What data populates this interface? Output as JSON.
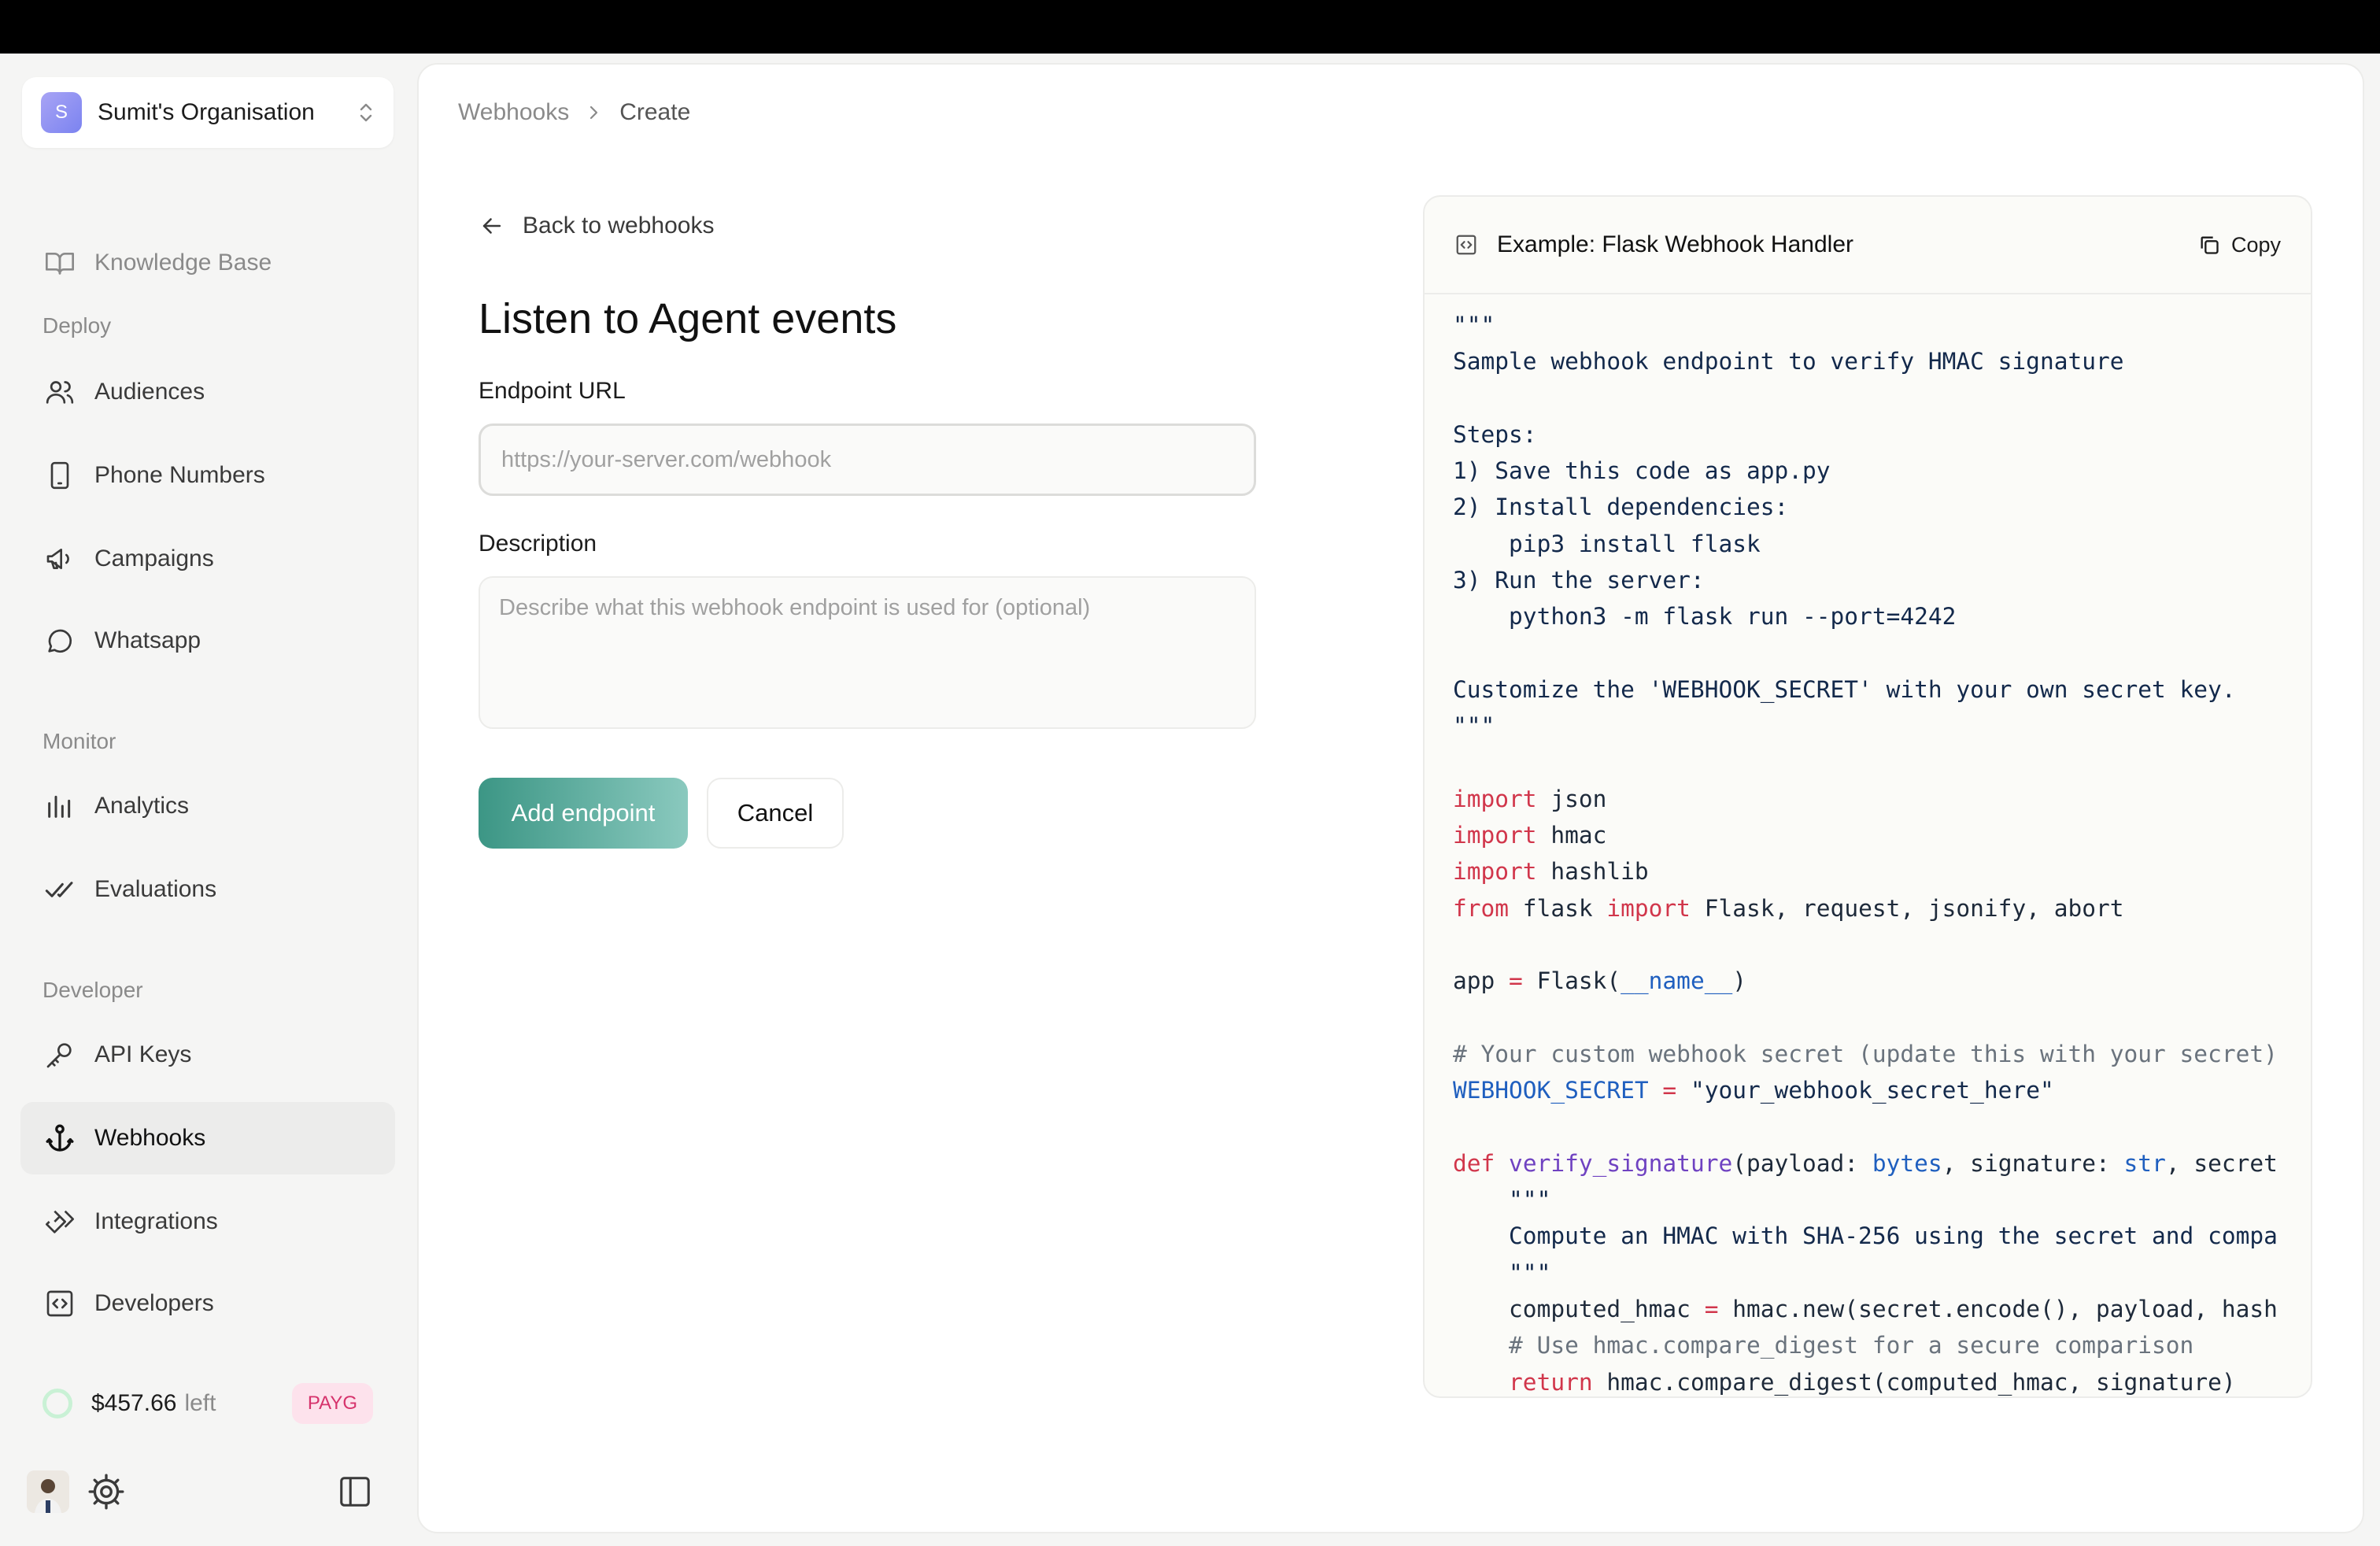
{
  "org": {
    "initial": "S",
    "name": "Sumit's Organisation"
  },
  "sidebar": {
    "knowledge_base": "Knowledge Base",
    "sections": {
      "deploy": "Deploy",
      "monitor": "Monitor",
      "developer": "Developer"
    },
    "items": {
      "audiences": "Audiences",
      "phone_numbers": "Phone Numbers",
      "campaigns": "Campaigns",
      "whatsapp": "Whatsapp",
      "analytics": "Analytics",
      "evaluations": "Evaluations",
      "api_keys": "API Keys",
      "webhooks": "Webhooks",
      "integrations": "Integrations",
      "developers": "Developers"
    },
    "credits": {
      "amount": "$457.66",
      "suffix": "left",
      "plan": "PAYG"
    }
  },
  "breadcrumb": {
    "parent": "Webhooks",
    "current": "Create"
  },
  "form": {
    "back_label": "Back to webhooks",
    "title": "Listen to Agent events",
    "endpoint_label": "Endpoint URL",
    "endpoint_placeholder": "https://your-server.com/webhook",
    "endpoint_value": "",
    "description_label": "Description",
    "description_placeholder": "Describe what this webhook endpoint is used for (optional)",
    "submit_label": "Add endpoint",
    "cancel_label": "Cancel"
  },
  "code_example": {
    "title": "Example: Flask Webhook Handler",
    "copy_label": "Copy",
    "lines": {
      "l1": "\"\"\"",
      "l2": "Sample webhook endpoint to verify HMAC signature",
      "l3": "Steps:",
      "l4": "1) Save this code as app.py",
      "l5": "2) Install dependencies:",
      "l6": "    pip3 install flask",
      "l7": "3) Run the server:",
      "l8": "    python3 -m flask run --port=4242",
      "l9": "Customize the 'WEBHOOK_SECRET' with your own secret key.",
      "l10": "\"\"\"",
      "kw_import": "import",
      "kw_from": "from",
      "mod_json": " json",
      "mod_hmac": " hmac",
      "mod_hashlib": " hashlib",
      "from_flask": " flask ",
      "flask_names": " Flask, request, jsonify, abort",
      "app_lhs": "app ",
      "eq": "=",
      "app_rhs": " Flask(",
      "dunder_name": "__name__",
      "close_paren": ")",
      "comment_secret": "# Your custom webhook secret (update this with your secret)",
      "secret_var": "WEBHOOK_SECRET",
      "secret_val": " \"your_webhook_secret_here\"",
      "kw_def": "def",
      "fn_name": " verify_signature",
      "sig_open": "(payload: ",
      "t_bytes": "bytes",
      "sig_mid": ", signature: ",
      "t_str": "str",
      "sig_rest": ", secret",
      "doc_open": "    \"\"\"",
      "doc_text": "    Compute an HMAC with SHA-256 using the secret and compa",
      "doc_close": "    \"\"\"",
      "computed": "    computed_hmac ",
      "computed_rhs": " hmac.new(secret.encode(), payload, hash",
      "comment_compare": "    # Use hmac.compare_digest for a secure comparison",
      "return_indent": "    ",
      "kw_return": "return",
      "return_rhs": " hmac.compare_digest(computed_hmac, signature)"
    }
  }
}
